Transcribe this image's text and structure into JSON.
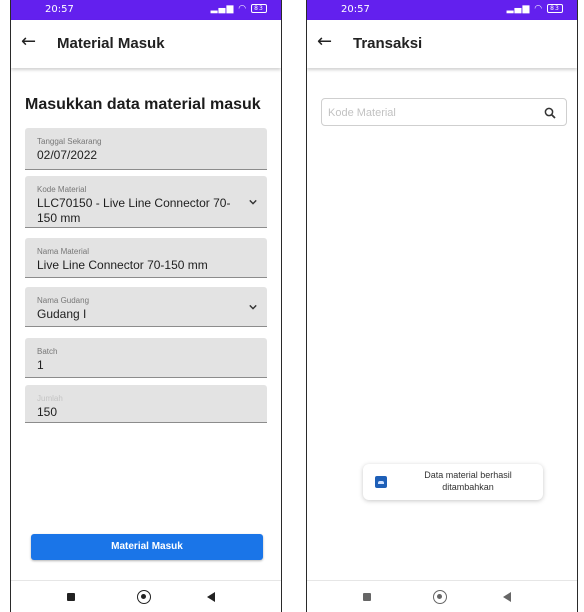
{
  "left_screen": {
    "status": {
      "time": "20:57",
      "battery": "83"
    },
    "app_bar": {
      "title": "Material Masuk"
    },
    "form": {
      "heading": "Masukkan data material masuk",
      "fields": [
        {
          "label": "Tanggal Sekarang",
          "value": "02/07/2022",
          "dropdown": false
        },
        {
          "label": "Kode Material",
          "value": "LLC70150 - Live Line Connector 70-150 mm",
          "dropdown": true
        },
        {
          "label": "Nama Material",
          "value": "Live Line Connector 70-150 mm",
          "dropdown": false
        },
        {
          "label": "Nama Gudang",
          "value": "Gudang I",
          "dropdown": true
        },
        {
          "label": "Batch",
          "value": "1",
          "dropdown": false
        },
        {
          "label": "Jumlah",
          "value": "150",
          "dropdown": false
        }
      ],
      "submit_label": "Material Masuk"
    }
  },
  "right_screen": {
    "status": {
      "time": "20:57",
      "battery": "83"
    },
    "app_bar": {
      "title": "Transaksi"
    },
    "search": {
      "placeholder": "Kode Material",
      "value": ""
    },
    "toast": {
      "message": "Data material berhasil ditambahkan"
    }
  },
  "colors": {
    "status_bar": "#6320ee",
    "primary_button": "#1a75e8",
    "field_bg": "#e3e3e3"
  }
}
